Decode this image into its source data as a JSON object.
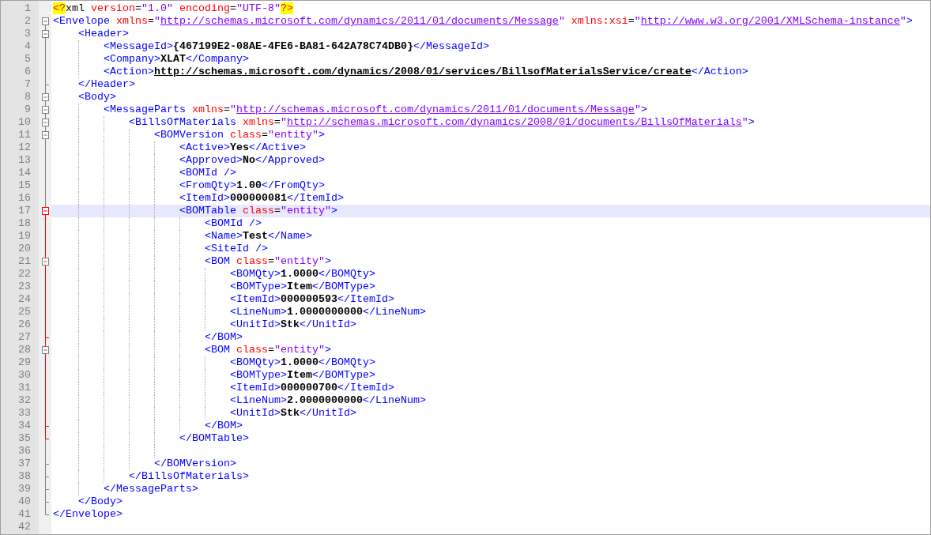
{
  "editor": {
    "lines": [
      {
        "line": "1",
        "selected": false,
        "tokens": [
          {
            "kind": "pi",
            "text": "<?"
          },
          {
            "kind": "plain",
            "text": "xml"
          },
          {
            "kind": "attr",
            "text": " version"
          },
          {
            "kind": "plain",
            "text": "="
          },
          {
            "kind": "value",
            "text": "\"1.0\""
          },
          {
            "kind": "attr",
            "text": " encoding"
          },
          {
            "kind": "plain",
            "text": "="
          },
          {
            "kind": "value",
            "text": "\"UTF-8\""
          },
          {
            "kind": "pi",
            "text": "?>"
          }
        ]
      },
      {
        "line": "2",
        "selected": false,
        "tokens": [
          {
            "kind": "tag",
            "text": "<Envelope"
          },
          {
            "kind": "attr",
            "text": " xmlns"
          },
          {
            "kind": "plain",
            "text": "="
          },
          {
            "kind": "value",
            "text": "\""
          },
          {
            "kind": "url",
            "text": "http://schemas.microsoft.com/dynamics/2011/01/documents/Message"
          },
          {
            "kind": "value",
            "text": "\""
          },
          {
            "kind": "attr",
            "text": " xmlns:xsi"
          },
          {
            "kind": "plain",
            "text": "="
          },
          {
            "kind": "value",
            "text": "\""
          },
          {
            "kind": "url",
            "text": "http://www.w3.org/2001/XMLSchema-instance"
          },
          {
            "kind": "value",
            "text": "\""
          },
          {
            "kind": "tag",
            "text": ">"
          }
        ],
        "children": [
          {
            "line": "3",
            "selected": false,
            "tokens": [
              {
                "kind": "tag",
                "text": "<Header>"
              }
            ],
            "children": [
              {
                "line": "4",
                "selected": false,
                "tokens": [
                  {
                    "kind": "tag",
                    "text": "<MessageId>"
                  },
                  {
                    "kind": "text",
                    "text": "{467199E2-08AE-4FE6-BA81-642A78C74DB0}"
                  },
                  {
                    "kind": "tag",
                    "text": "</MessageId>"
                  }
                ]
              },
              {
                "line": "5",
                "selected": false,
                "tokens": [
                  {
                    "kind": "tag",
                    "text": "<Company>"
                  },
                  {
                    "kind": "text",
                    "text": "XLAT"
                  },
                  {
                    "kind": "tag",
                    "text": "</Company>"
                  }
                ]
              },
              {
                "line": "6",
                "selected": false,
                "tokens": [
                  {
                    "kind": "tag",
                    "text": "<Action>"
                  },
                  {
                    "kind": "text-url",
                    "text": "http://schemas.microsoft.com/dynamics/2008/01/services/BillsofMaterialsService/create"
                  },
                  {
                    "kind": "tag",
                    "text": "</Action>"
                  }
                ]
              }
            ],
            "closing": {
              "line": "7",
              "tokens": [
                {
                  "kind": "tag",
                  "text": "</Header>"
                }
              ]
            }
          },
          {
            "line": "8",
            "selected": false,
            "tokens": [
              {
                "kind": "tag",
                "text": "<Body>"
              }
            ],
            "children": [
              {
                "line": "9",
                "selected": false,
                "tokens": [
                  {
                    "kind": "tag",
                    "text": "<MessageParts"
                  },
                  {
                    "kind": "attr",
                    "text": " xmlns"
                  },
                  {
                    "kind": "plain",
                    "text": "="
                  },
                  {
                    "kind": "value",
                    "text": "\""
                  },
                  {
                    "kind": "url",
                    "text": "http://schemas.microsoft.com/dynamics/2011/01/documents/Message"
                  },
                  {
                    "kind": "value",
                    "text": "\""
                  },
                  {
                    "kind": "tag",
                    "text": ">"
                  }
                ],
                "children": [
                  {
                    "line": "10",
                    "selected": false,
                    "tokens": [
                      {
                        "kind": "tag",
                        "text": "<BillsOfMaterials"
                      },
                      {
                        "kind": "attr",
                        "text": " xmlns"
                      },
                      {
                        "kind": "plain",
                        "text": "="
                      },
                      {
                        "kind": "value",
                        "text": "\""
                      },
                      {
                        "kind": "url",
                        "text": "http://schemas.microsoft.com/dynamics/2008/01/documents/BillsOfMaterials"
                      },
                      {
                        "kind": "value",
                        "text": "\""
                      },
                      {
                        "kind": "tag",
                        "text": ">"
                      }
                    ],
                    "children": [
                      {
                        "line": "11",
                        "selected": false,
                        "tokens": [
                          {
                            "kind": "tag",
                            "text": "<BOMVersion"
                          },
                          {
                            "kind": "attr",
                            "text": " class"
                          },
                          {
                            "kind": "plain",
                            "text": "="
                          },
                          {
                            "kind": "value",
                            "text": "\"entity\""
                          },
                          {
                            "kind": "tag",
                            "text": ">"
                          }
                        ],
                        "children": [
                          {
                            "line": "12",
                            "selected": false,
                            "tokens": [
                              {
                                "kind": "tag",
                                "text": "<Active>"
                              },
                              {
                                "kind": "text",
                                "text": "Yes"
                              },
                              {
                                "kind": "tag",
                                "text": "</Active>"
                              }
                            ]
                          },
                          {
                            "line": "13",
                            "selected": false,
                            "tokens": [
                              {
                                "kind": "tag",
                                "text": "<Approved>"
                              },
                              {
                                "kind": "text",
                                "text": "No"
                              },
                              {
                                "kind": "tag",
                                "text": "</Approved>"
                              }
                            ]
                          },
                          {
                            "line": "14",
                            "selected": false,
                            "tokens": [
                              {
                                "kind": "tag",
                                "text": "<BOMId />"
                              }
                            ]
                          },
                          {
                            "line": "15",
                            "selected": false,
                            "tokens": [
                              {
                                "kind": "tag",
                                "text": "<FromQty>"
                              },
                              {
                                "kind": "text",
                                "text": "1.00"
                              },
                              {
                                "kind": "tag",
                                "text": "</FromQty>"
                              }
                            ]
                          },
                          {
                            "line": "16",
                            "selected": false,
                            "tokens": [
                              {
                                "kind": "tag",
                                "text": "<ItemId>"
                              },
                              {
                                "kind": "text",
                                "text": "000000081"
                              },
                              {
                                "kind": "tag",
                                "text": "</ItemId>"
                              }
                            ]
                          },
                          {
                            "line": "17",
                            "selected": true,
                            "tokens": [
                              {
                                "kind": "tag",
                                "text": "<BOMTable"
                              },
                              {
                                "kind": "attr",
                                "text": " class"
                              },
                              {
                                "kind": "plain",
                                "text": "="
                              },
                              {
                                "kind": "value",
                                "text": "\"entity\""
                              },
                              {
                                "kind": "tag",
                                "text": ">"
                              }
                            ],
                            "children": [
                              {
                                "line": "18",
                                "selected": false,
                                "tokens": [
                                  {
                                    "kind": "tag",
                                    "text": "<BOMId />"
                                  }
                                ]
                              },
                              {
                                "line": "19",
                                "selected": false,
                                "tokens": [
                                  {
                                    "kind": "tag",
                                    "text": "<Name>"
                                  },
                                  {
                                    "kind": "text",
                                    "text": "Test"
                                  },
                                  {
                                    "kind": "tag",
                                    "text": "</Name>"
                                  }
                                ]
                              },
                              {
                                "line": "20",
                                "selected": false,
                                "tokens": [
                                  {
                                    "kind": "tag",
                                    "text": "<SiteId />"
                                  }
                                ]
                              },
                              {
                                "line": "21",
                                "selected": false,
                                "tokens": [
                                  {
                                    "kind": "tag",
                                    "text": "<BOM"
                                  },
                                  {
                                    "kind": "attr",
                                    "text": " class"
                                  },
                                  {
                                    "kind": "plain",
                                    "text": "="
                                  },
                                  {
                                    "kind": "value",
                                    "text": "\"entity\""
                                  },
                                  {
                                    "kind": "tag",
                                    "text": ">"
                                  }
                                ],
                                "children": [
                                  {
                                    "line": "22",
                                    "selected": false,
                                    "tokens": [
                                      {
                                        "kind": "tag",
                                        "text": "<BOMQty>"
                                      },
                                      {
                                        "kind": "text",
                                        "text": "1.0000"
                                      },
                                      {
                                        "kind": "tag",
                                        "text": "</BOMQty>"
                                      }
                                    ]
                                  },
                                  {
                                    "line": "23",
                                    "selected": false,
                                    "tokens": [
                                      {
                                        "kind": "tag",
                                        "text": "<BOMType>"
                                      },
                                      {
                                        "kind": "text",
                                        "text": "Item"
                                      },
                                      {
                                        "kind": "tag",
                                        "text": "</BOMType>"
                                      }
                                    ]
                                  },
                                  {
                                    "line": "24",
                                    "selected": false,
                                    "tokens": [
                                      {
                                        "kind": "tag",
                                        "text": "<ItemId>"
                                      },
                                      {
                                        "kind": "text",
                                        "text": "000000593"
                                      },
                                      {
                                        "kind": "tag",
                                        "text": "</ItemId>"
                                      }
                                    ]
                                  },
                                  {
                                    "line": "25",
                                    "selected": false,
                                    "tokens": [
                                      {
                                        "kind": "tag",
                                        "text": "<LineNum>"
                                      },
                                      {
                                        "kind": "text",
                                        "text": "1.0000000000"
                                      },
                                      {
                                        "kind": "tag",
                                        "text": "</LineNum>"
                                      }
                                    ]
                                  },
                                  {
                                    "line": "26",
                                    "selected": false,
                                    "tokens": [
                                      {
                                        "kind": "tag",
                                        "text": "<UnitId>"
                                      },
                                      {
                                        "kind": "text",
                                        "text": "Stk"
                                      },
                                      {
                                        "kind": "tag",
                                        "text": "</UnitId>"
                                      }
                                    ]
                                  }
                                ],
                                "closing": {
                                  "line": "27",
                                  "tokens": [
                                    {
                                      "kind": "tag",
                                      "text": "</BOM>"
                                    }
                                  ]
                                }
                              },
                              {
                                "line": "28",
                                "selected": false,
                                "tokens": [
                                  {
                                    "kind": "tag",
                                    "text": "<BOM"
                                  },
                                  {
                                    "kind": "attr",
                                    "text": " class"
                                  },
                                  {
                                    "kind": "plain",
                                    "text": "="
                                  },
                                  {
                                    "kind": "value",
                                    "text": "\"entity\""
                                  },
                                  {
                                    "kind": "tag",
                                    "text": ">"
                                  }
                                ],
                                "children": [
                                  {
                                    "line": "29",
                                    "selected": false,
                                    "tokens": [
                                      {
                                        "kind": "tag",
                                        "text": "<BOMQty>"
                                      },
                                      {
                                        "kind": "text",
                                        "text": "1.0000"
                                      },
                                      {
                                        "kind": "tag",
                                        "text": "</BOMQty>"
                                      }
                                    ]
                                  },
                                  {
                                    "line": "30",
                                    "selected": false,
                                    "tokens": [
                                      {
                                        "kind": "tag",
                                        "text": "<BOMType>"
                                      },
                                      {
                                        "kind": "text",
                                        "text": "Item"
                                      },
                                      {
                                        "kind": "tag",
                                        "text": "</BOMType>"
                                      }
                                    ]
                                  },
                                  {
                                    "line": "31",
                                    "selected": false,
                                    "tokens": [
                                      {
                                        "kind": "tag",
                                        "text": "<ItemId>"
                                      },
                                      {
                                        "kind": "text",
                                        "text": "000000700"
                                      },
                                      {
                                        "kind": "tag",
                                        "text": "</ItemId>"
                                      }
                                    ]
                                  },
                                  {
                                    "line": "32",
                                    "selected": false,
                                    "tokens": [
                                      {
                                        "kind": "tag",
                                        "text": "<LineNum>"
                                      },
                                      {
                                        "kind": "text",
                                        "text": "2.0000000000"
                                      },
                                      {
                                        "kind": "tag",
                                        "text": "</LineNum>"
                                      }
                                    ]
                                  },
                                  {
                                    "line": "33",
                                    "selected": false,
                                    "tokens": [
                                      {
                                        "kind": "tag",
                                        "text": "<UnitId>"
                                      },
                                      {
                                        "kind": "text",
                                        "text": "Stk"
                                      },
                                      {
                                        "kind": "tag",
                                        "text": "</UnitId>"
                                      }
                                    ]
                                  }
                                ],
                                "closing": {
                                  "line": "34",
                                  "tokens": [
                                    {
                                      "kind": "tag",
                                      "text": "</BOM>"
                                    }
                                  ]
                                }
                              }
                            ],
                            "closing": {
                              "line": "35",
                              "tokens": [
                                {
                                  "kind": "tag",
                                  "text": "</BOMTable>"
                                }
                              ]
                            }
                          },
                          {
                            "line": "36",
                            "selected": false
                          }
                        ],
                        "closing": {
                          "line": "37",
                          "tokens": [
                            {
                              "kind": "tag",
                              "text": "</BOMVersion>"
                            }
                          ]
                        }
                      }
                    ],
                    "closing": {
                      "line": "38",
                      "tokens": [
                        {
                          "kind": "tag",
                          "text": "</BillsOfMaterials>"
                        }
                      ]
                    }
                  }
                ],
                "closing": {
                  "line": "39",
                  "tokens": [
                    {
                      "kind": "tag",
                      "text": "</MessageParts>"
                    }
                  ]
                }
              }
            ],
            "closing": {
              "line": "40",
              "tokens": [
                {
                  "kind": "tag",
                  "text": "</Body>"
                }
              ]
            }
          }
        ],
        "closing": {
          "line": "41",
          "tokens": [
            {
              "kind": "tag",
              "text": "</Envelope>"
            }
          ]
        }
      },
      {
        "line": "42",
        "selected": false
      }
    ]
  }
}
